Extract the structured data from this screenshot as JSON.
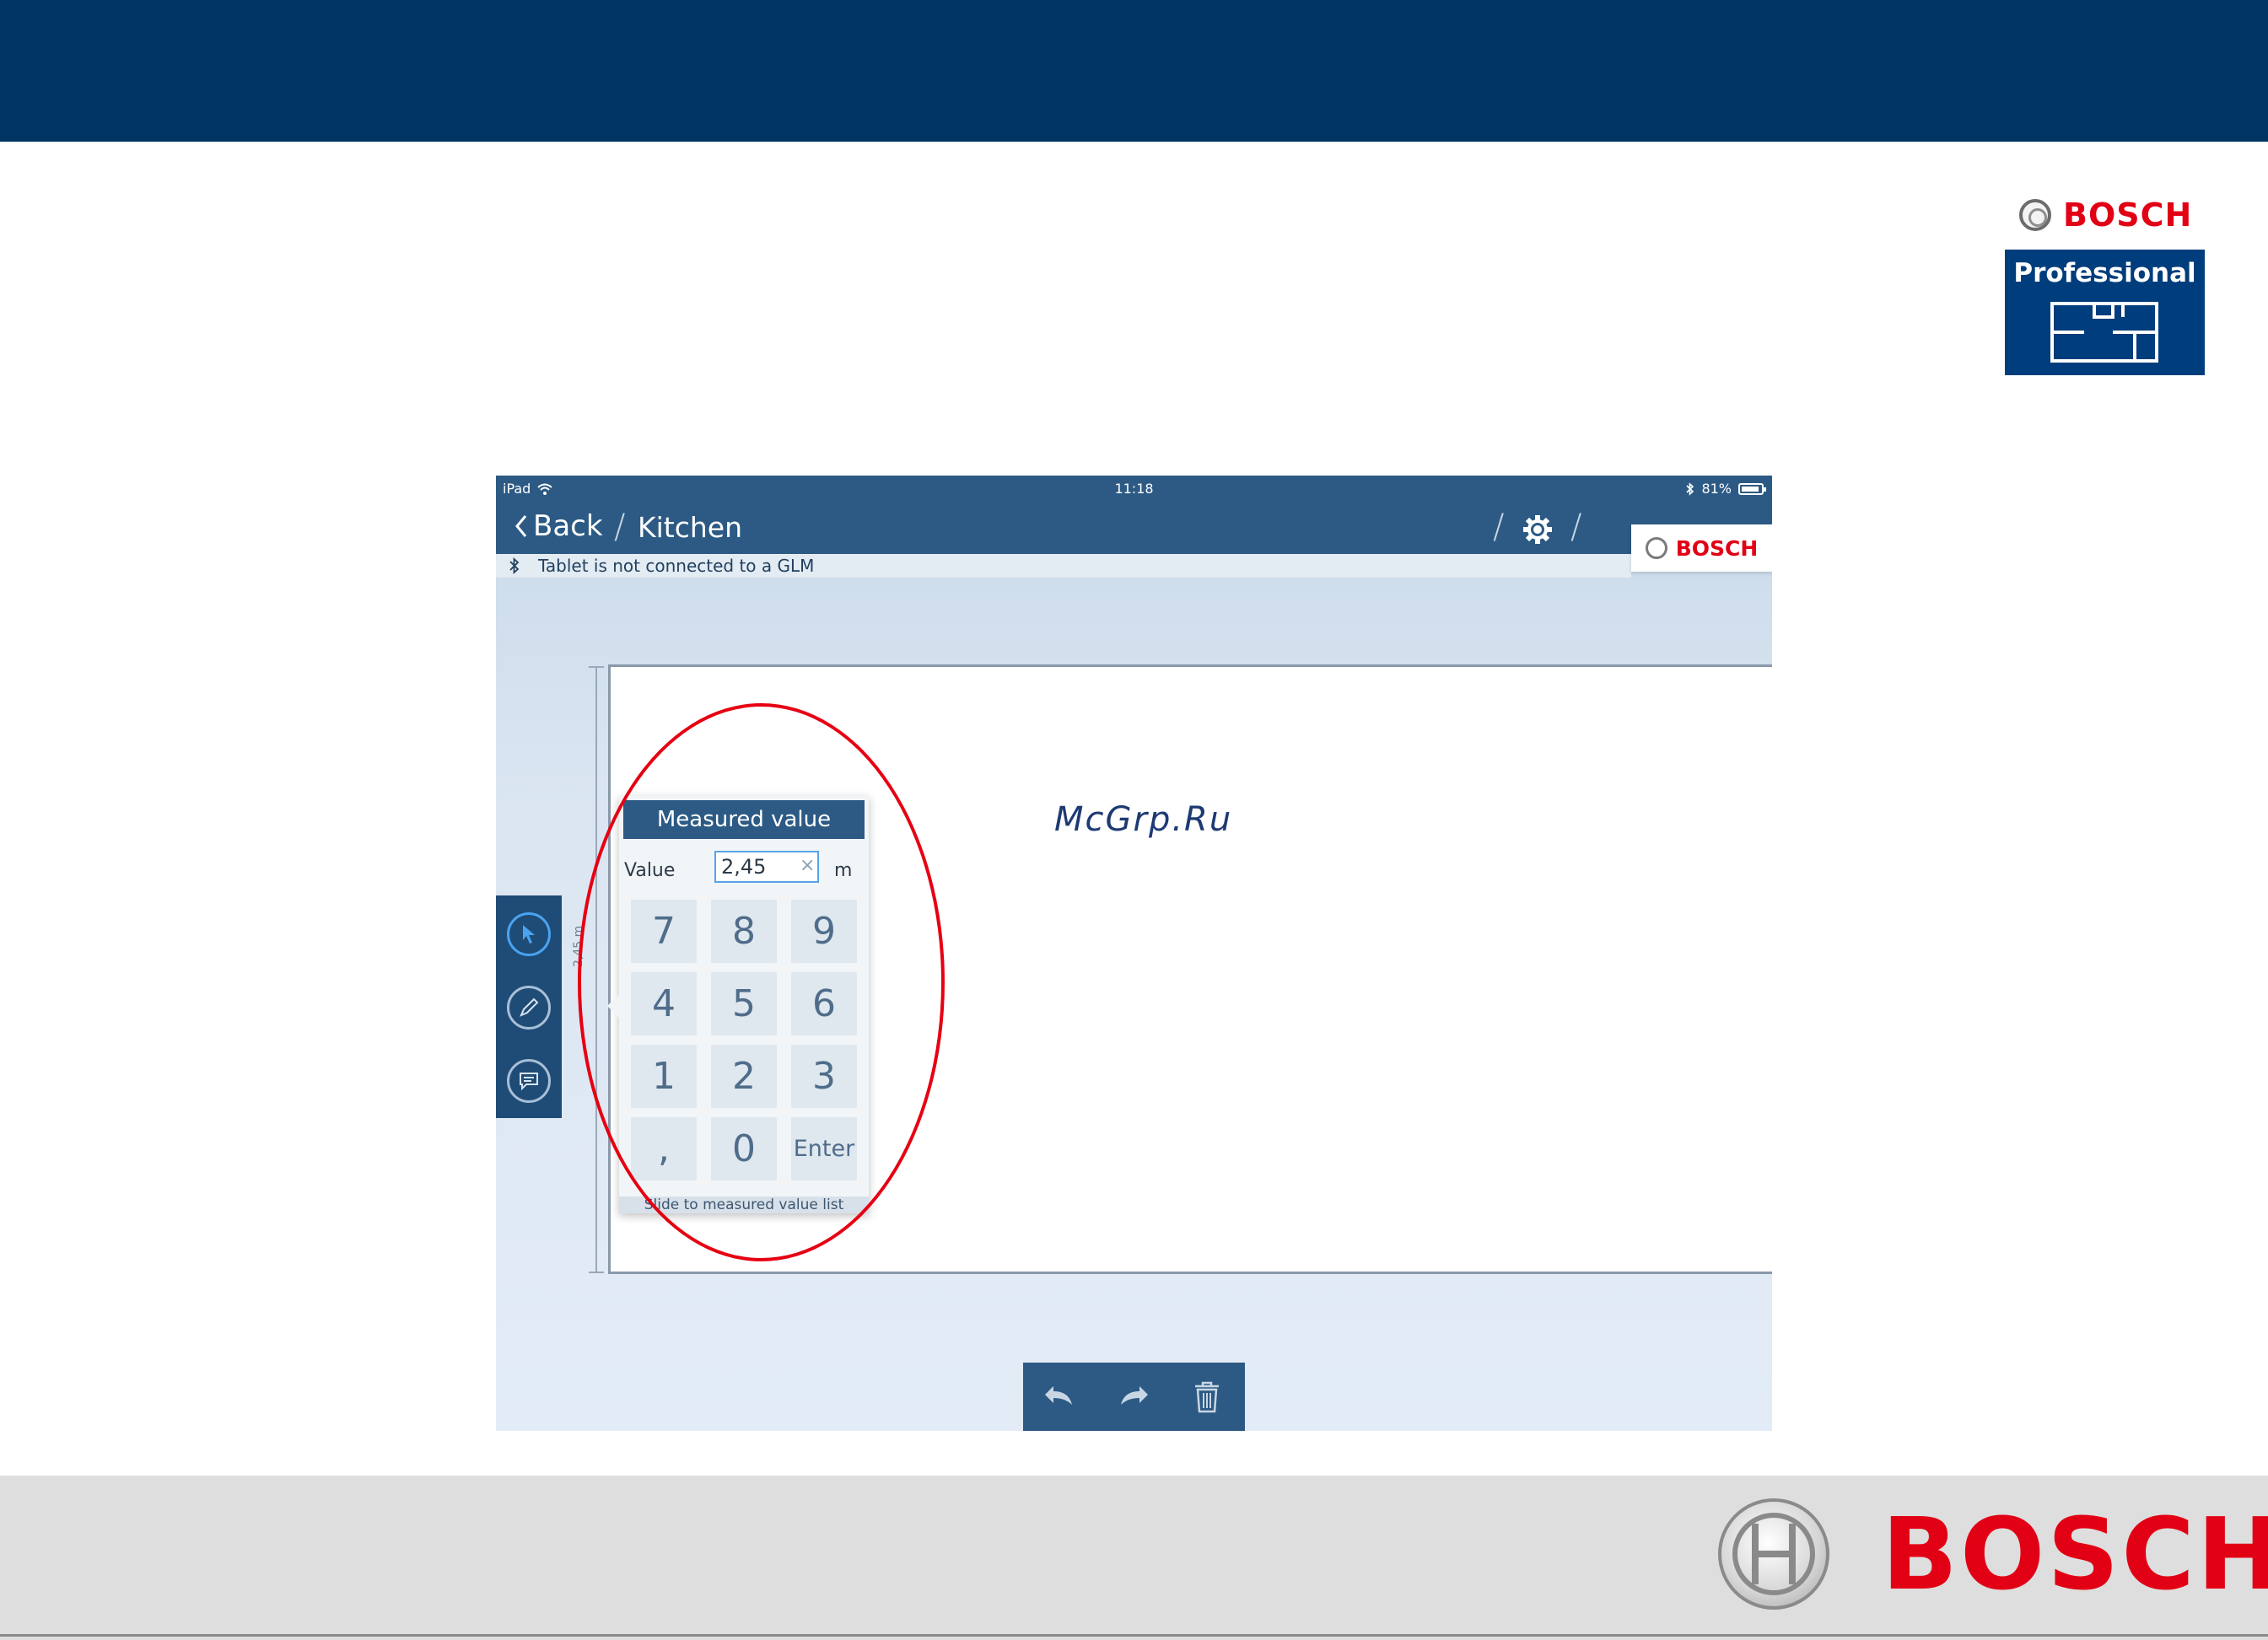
{
  "slide": {
    "brand_name": "BOSCH",
    "product_line": "Professional",
    "bottom_brand": "BOSCH"
  },
  "status_bar": {
    "device": "iPad",
    "time": "11:18",
    "battery": "81%"
  },
  "nav": {
    "back_label": "Back",
    "breadcrumb": "Kitchen",
    "tab_brand": "BOSCH"
  },
  "info_bar": {
    "message": "Tablet is not connected to a GLM"
  },
  "drawing": {
    "dimension_label": "2,45 m"
  },
  "popup": {
    "title": "Measured value",
    "value_label": "Value",
    "value": "2,45",
    "clear_symbol": "×",
    "unit": "m",
    "keys": [
      "7",
      "8",
      "9",
      "4",
      "5",
      "6",
      "1",
      "2",
      "3",
      ",",
      "0",
      "Enter"
    ],
    "footer": "Slide to measured value list"
  },
  "watermark": "McGrp.Ru",
  "icons": {
    "tools": [
      "pointer-icon",
      "pencil-icon",
      "comment-icon"
    ],
    "toolbar": [
      "undo-icon",
      "redo-icon",
      "trash-icon"
    ],
    "nav": [
      "chevron-left-icon",
      "gear-icon"
    ]
  },
  "colors": {
    "header_blue": "#003462",
    "app_blue": "#2c5a84",
    "bosch_red": "#e20015",
    "highlight_red": "#e60012"
  }
}
